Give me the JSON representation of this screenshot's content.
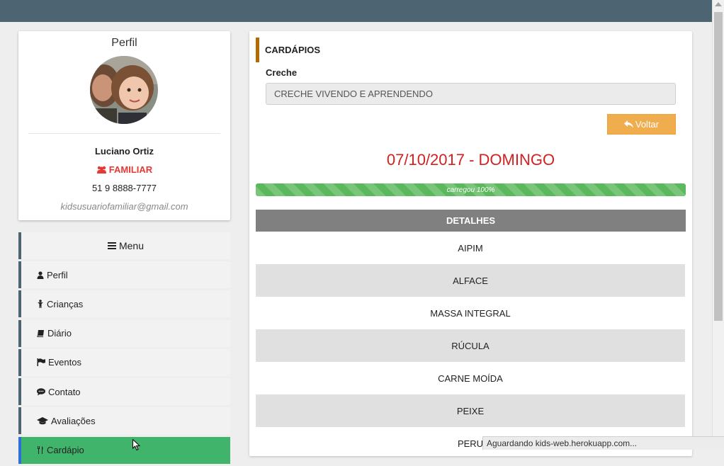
{
  "profile": {
    "title": "Perfil",
    "name": "Luciano Ortiz",
    "role": "FAMILIAR",
    "phone": "51 9 8888-7777",
    "email": "kidsusuariofamiliar@gmail.com"
  },
  "menu": {
    "header": "Menu",
    "items": [
      {
        "label": "Perfil",
        "icon": "user-icon"
      },
      {
        "label": "Crianças",
        "icon": "child-icon"
      },
      {
        "label": "Diário",
        "icon": "book-icon"
      },
      {
        "label": "Eventos",
        "icon": "flag-icon"
      },
      {
        "label": "Contato",
        "icon": "comment-icon"
      },
      {
        "label": "Avaliações",
        "icon": "graduation-cap-icon"
      },
      {
        "label": "Cardápio",
        "icon": "cutlery-icon"
      }
    ],
    "active_index": 6
  },
  "main": {
    "section_title": "CARDÁPIOS",
    "creche_label": "Creche",
    "creche_value": "CRECHE VIVENDO E APRENDENDO",
    "back_label": "Voltar",
    "date_title": "07/10/2017 - DOMINGO",
    "progress_text": "carregou 100%",
    "progress_value": 1.0,
    "details_header": "DETALHES",
    "details": [
      "AIPIM",
      "ALFACE",
      "MASSA INTEGRAL",
      "RÚCULA",
      "CARNE MOÍDA",
      "PEIXE",
      "PERU"
    ]
  },
  "status_bar": "Aguardando kids-web.herokuapp.com...",
  "colors": {
    "topbar": "#4d6473",
    "accent_orange": "#f0ad4e",
    "role_red": "#e53935",
    "date_red": "#d32020",
    "progress_green": "#5cb85c",
    "active_menu": "#3fb46a"
  }
}
